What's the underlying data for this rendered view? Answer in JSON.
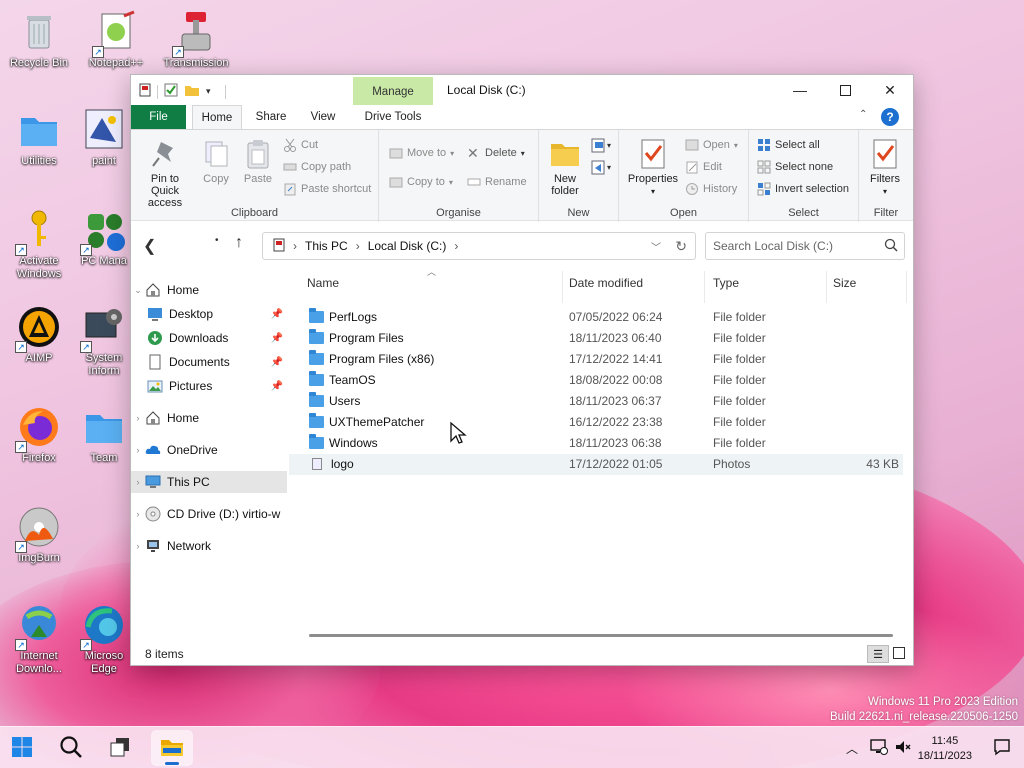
{
  "desktop": {
    "icons": [
      {
        "name": "Recycle Bin"
      },
      {
        "name": "Notepad++"
      },
      {
        "name": "Transmission"
      },
      {
        "name": "Utilities"
      },
      {
        "name": "paint"
      },
      {
        "name": "Activate Windows"
      },
      {
        "name": "PC Mana"
      },
      {
        "name": "AIMP"
      },
      {
        "name": "System Inform"
      },
      {
        "name": "Firefox"
      },
      {
        "name": "Team"
      },
      {
        "name": "ImgBurn"
      },
      {
        "name": "Internet Downlo..."
      },
      {
        "name": "Microso Edge"
      }
    ],
    "watermark_line1": "Windows 11 Pro 2023 Edition",
    "watermark_line2": "Build 22621.ni_release.220506-1250"
  },
  "taskbar": {
    "clock_time": "11:45",
    "clock_date": "18/11/2023"
  },
  "window": {
    "title": "Local Disk (C:)",
    "context_tab": "Manage",
    "tabs": [
      "File",
      "Home",
      "Share",
      "View",
      "Drive Tools"
    ],
    "ribbon": {
      "clipboard": {
        "pin": "Pin to Quick access",
        "copy": "Copy",
        "paste": "Paste",
        "cut": "Cut",
        "copy_path": "Copy path",
        "paste_shortcut": "Paste shortcut",
        "group": "Clipboard"
      },
      "organise": {
        "move_to": "Move to",
        "copy_to": "Copy to",
        "delete": "Delete",
        "rename": "Rename",
        "group": "Organise"
      },
      "new": {
        "new_folder": "New folder",
        "group": "New"
      },
      "open": {
        "properties": "Properties",
        "open": "Open",
        "edit": "Edit",
        "history": "History",
        "group": "Open"
      },
      "select": {
        "select_all": "Select all",
        "select_none": "Select none",
        "invert": "Invert selection",
        "group": "Select"
      },
      "filter": {
        "filters": "Filters",
        "group": "Filter"
      }
    },
    "address": {
      "crumbs": [
        "This PC",
        "Local Disk (C:)"
      ]
    },
    "search_placeholder": "Search Local Disk (C:)",
    "nav": {
      "home": "Home",
      "desktop": "Desktop",
      "downloads": "Downloads",
      "documents": "Documents",
      "pictures": "Pictures",
      "home2": "Home",
      "onedrive": "OneDrive",
      "thispc": "This PC",
      "cd": "CD Drive (D:) virtio-w",
      "network": "Network"
    },
    "columns": {
      "name": "Name",
      "date": "Date modified",
      "type": "Type",
      "size": "Size"
    },
    "files": [
      {
        "name": "PerfLogs",
        "date": "07/05/2022 06:24",
        "type": "File folder",
        "size": ""
      },
      {
        "name": "Program Files",
        "date": "18/11/2023 06:40",
        "type": "File folder",
        "size": ""
      },
      {
        "name": "Program Files (x86)",
        "date": "17/12/2022 14:41",
        "type": "File folder",
        "size": ""
      },
      {
        "name": "TeamOS",
        "date": "18/08/2022 00:08",
        "type": "File folder",
        "size": ""
      },
      {
        "name": "Users",
        "date": "18/11/2023 06:37",
        "type": "File folder",
        "size": ""
      },
      {
        "name": "UXThemePatcher",
        "date": "16/12/2022 23:38",
        "type": "File folder",
        "size": ""
      },
      {
        "name": "Windows",
        "date": "18/11/2023 06:38",
        "type": "File folder",
        "size": ""
      },
      {
        "name": "logo",
        "date": "17/12/2022 01:05",
        "type": "Photos",
        "size": "43 KB"
      }
    ],
    "status": "8 items"
  }
}
